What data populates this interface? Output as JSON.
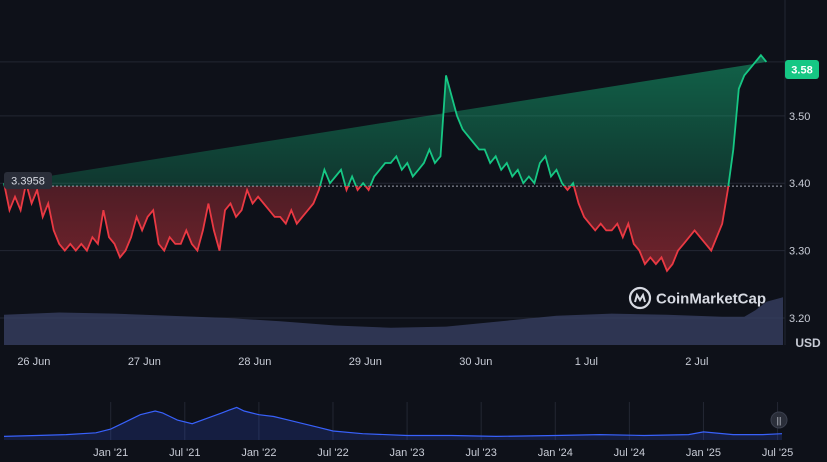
{
  "colors": {
    "background": "#0e1119",
    "grid": "#232733",
    "up": "#16c784",
    "down": "#ea3943",
    "volume": "#3a4266",
    "navigator": "#3861fb"
  },
  "brand": {
    "name": "CoinMarketCap",
    "icon": "coinmarketcap-logo-icon"
  },
  "price_tag": {
    "label": "3.58"
  },
  "reference_tag": {
    "label": "3.3958"
  },
  "navigator_handle": {
    "icon": "pause-handle-icon",
    "label": "||"
  },
  "chart_data": {
    "type": "line",
    "unit_label": "USD",
    "reference_value": 3.3958,
    "latest_value": 3.58,
    "ylim": [
      3.16,
      3.66
    ],
    "y_ticks": [
      3.2,
      3.3,
      3.4,
      3.5,
      3.58
    ],
    "y_tick_labels": [
      "3.20",
      "3.30",
      "3.40",
      "3.50"
    ],
    "x_tick_labels": [
      "26 Jun",
      "27 Jun",
      "28 Jun",
      "29 Jun",
      "30 Jun",
      "1 Jul",
      "2 Jul"
    ],
    "x_range_days": [
      0,
      7.05
    ],
    "x_tick_days": [
      0.27,
      1.27,
      2.27,
      3.27,
      4.27,
      5.27,
      6.27
    ],
    "grid": true,
    "series": [
      {
        "x_days": [
          0,
          0.05,
          0.1,
          0.15,
          0.2,
          0.25,
          0.3,
          0.35,
          0.4,
          0.45,
          0.5,
          0.55,
          0.6,
          0.65,
          0.7,
          0.75,
          0.8,
          0.85,
          0.9,
          0.95,
          1.0,
          1.05,
          1.1,
          1.15,
          1.2,
          1.25,
          1.3,
          1.35,
          1.4,
          1.45,
          1.5,
          1.55,
          1.6,
          1.65,
          1.7,
          1.75,
          1.8,
          1.85,
          1.9,
          1.95,
          2.0,
          2.05,
          2.1,
          2.15,
          2.2,
          2.25,
          2.3,
          2.35,
          2.4,
          2.45,
          2.5,
          2.55,
          2.6,
          2.65,
          2.7,
          2.75,
          2.8,
          2.85,
          2.9,
          2.95,
          3.0,
          3.05,
          3.1,
          3.15,
          3.2,
          3.25,
          3.3,
          3.35,
          3.4,
          3.45,
          3.5,
          3.55,
          3.6,
          3.65,
          3.7,
          3.75,
          3.8,
          3.85,
          3.9,
          3.95,
          4.0,
          4.05,
          4.1,
          4.15,
          4.2,
          4.25,
          4.3,
          4.35,
          4.4,
          4.45,
          4.5,
          4.55,
          4.6,
          4.65,
          4.7,
          4.75,
          4.8,
          4.85,
          4.9,
          4.95,
          5.0,
          5.05,
          5.1,
          5.15,
          5.2,
          5.25,
          5.3,
          5.35,
          5.4,
          5.45,
          5.5,
          5.55,
          5.6,
          5.65,
          5.7,
          5.75,
          5.8,
          5.85,
          5.9,
          5.95,
          6.0,
          6.05,
          6.1,
          6.15,
          6.2,
          6.25,
          6.3,
          6.35,
          6.4,
          6.45,
          6.5,
          6.55,
          6.6,
          6.65,
          6.7,
          6.75,
          6.8,
          6.85,
          6.9,
          6.95,
          7.0,
          7.05
        ],
        "values": [
          3.4,
          3.36,
          3.38,
          3.36,
          3.4,
          3.37,
          3.39,
          3.35,
          3.37,
          3.33,
          3.31,
          3.3,
          3.31,
          3.3,
          3.31,
          3.3,
          3.32,
          3.31,
          3.36,
          3.32,
          3.31,
          3.29,
          3.3,
          3.32,
          3.35,
          3.33,
          3.35,
          3.36,
          3.31,
          3.3,
          3.32,
          3.31,
          3.31,
          3.33,
          3.31,
          3.3,
          3.33,
          3.37,
          3.33,
          3.3,
          3.36,
          3.37,
          3.35,
          3.36,
          3.39,
          3.37,
          3.38,
          3.37,
          3.36,
          3.35,
          3.35,
          3.34,
          3.36,
          3.34,
          3.35,
          3.36,
          3.37,
          3.39,
          3.42,
          3.4,
          3.41,
          3.42,
          3.39,
          3.41,
          3.39,
          3.4,
          3.39,
          3.41,
          3.42,
          3.43,
          3.43,
          3.44,
          3.42,
          3.43,
          3.41,
          3.42,
          3.43,
          3.45,
          3.43,
          3.44,
          3.56,
          3.53,
          3.5,
          3.48,
          3.47,
          3.46,
          3.45,
          3.45,
          3.43,
          3.44,
          3.42,
          3.43,
          3.41,
          3.42,
          3.4,
          3.41,
          3.4,
          3.43,
          3.44,
          3.41,
          3.42,
          3.4,
          3.39,
          3.4,
          3.37,
          3.35,
          3.34,
          3.33,
          3.34,
          3.33,
          3.33,
          3.34,
          3.32,
          3.34,
          3.31,
          3.3,
          3.28,
          3.29,
          3.28,
          3.29,
          3.27,
          3.28,
          3.3,
          3.31,
          3.32,
          3.33,
          3.32,
          3.31,
          3.3,
          3.32,
          3.34,
          3.39,
          3.45,
          3.54,
          3.56,
          3.57,
          3.58,
          3.59,
          3.58
        ]
      }
    ],
    "volume": {
      "x_days": [
        0,
        0.5,
        1.0,
        1.5,
        2.0,
        2.5,
        3.0,
        3.5,
        4.0,
        4.5,
        5.0,
        5.5,
        6.0,
        6.5,
        6.7,
        6.8,
        6.9,
        7.05
      ],
      "values": [
        28,
        30,
        29,
        27,
        25,
        22,
        18,
        16,
        17,
        22,
        27,
        29,
        28,
        26,
        26,
        32,
        40,
        44
      ]
    },
    "navigator": {
      "x_tick_labels": [
        "Jan '21",
        "Jul '21",
        "Jan '22",
        "Jul '22",
        "Jan '23",
        "Jul '23",
        "Jan '24",
        "Jul '24",
        "Jan '25",
        "Jul '25"
      ],
      "x_years": [
        2021.0,
        2021.5,
        2022.0,
        2022.5,
        2023.0,
        2023.5,
        2024.0,
        2024.5,
        2025.0,
        2025.5
      ],
      "x_range_years": [
        2020.28,
        2025.53
      ],
      "series_years": [
        2020.28,
        2020.5,
        2020.7,
        2020.9,
        2021.0,
        2021.1,
        2021.2,
        2021.3,
        2021.35,
        2021.4,
        2021.45,
        2021.55,
        2021.65,
        2021.75,
        2021.8,
        2021.85,
        2021.9,
        2022.0,
        2022.1,
        2022.2,
        2022.3,
        2022.4,
        2022.5,
        2022.7,
        2023.0,
        2023.3,
        2023.6,
        2024.0,
        2024.3,
        2024.6,
        2024.9,
        2025.0,
        2025.2,
        2025.4,
        2025.53
      ],
      "series_values": [
        0.4,
        0.5,
        0.6,
        0.8,
        1.2,
        2.0,
        2.8,
        3.2,
        3.0,
        2.6,
        2.2,
        1.8,
        2.4,
        3.0,
        3.3,
        3.6,
        3.2,
        2.8,
        2.6,
        2.2,
        1.8,
        1.4,
        1.0,
        0.7,
        0.5,
        0.5,
        0.4,
        0.5,
        0.6,
        0.5,
        0.6,
        0.9,
        0.6,
        0.6,
        0.7
      ]
    }
  }
}
